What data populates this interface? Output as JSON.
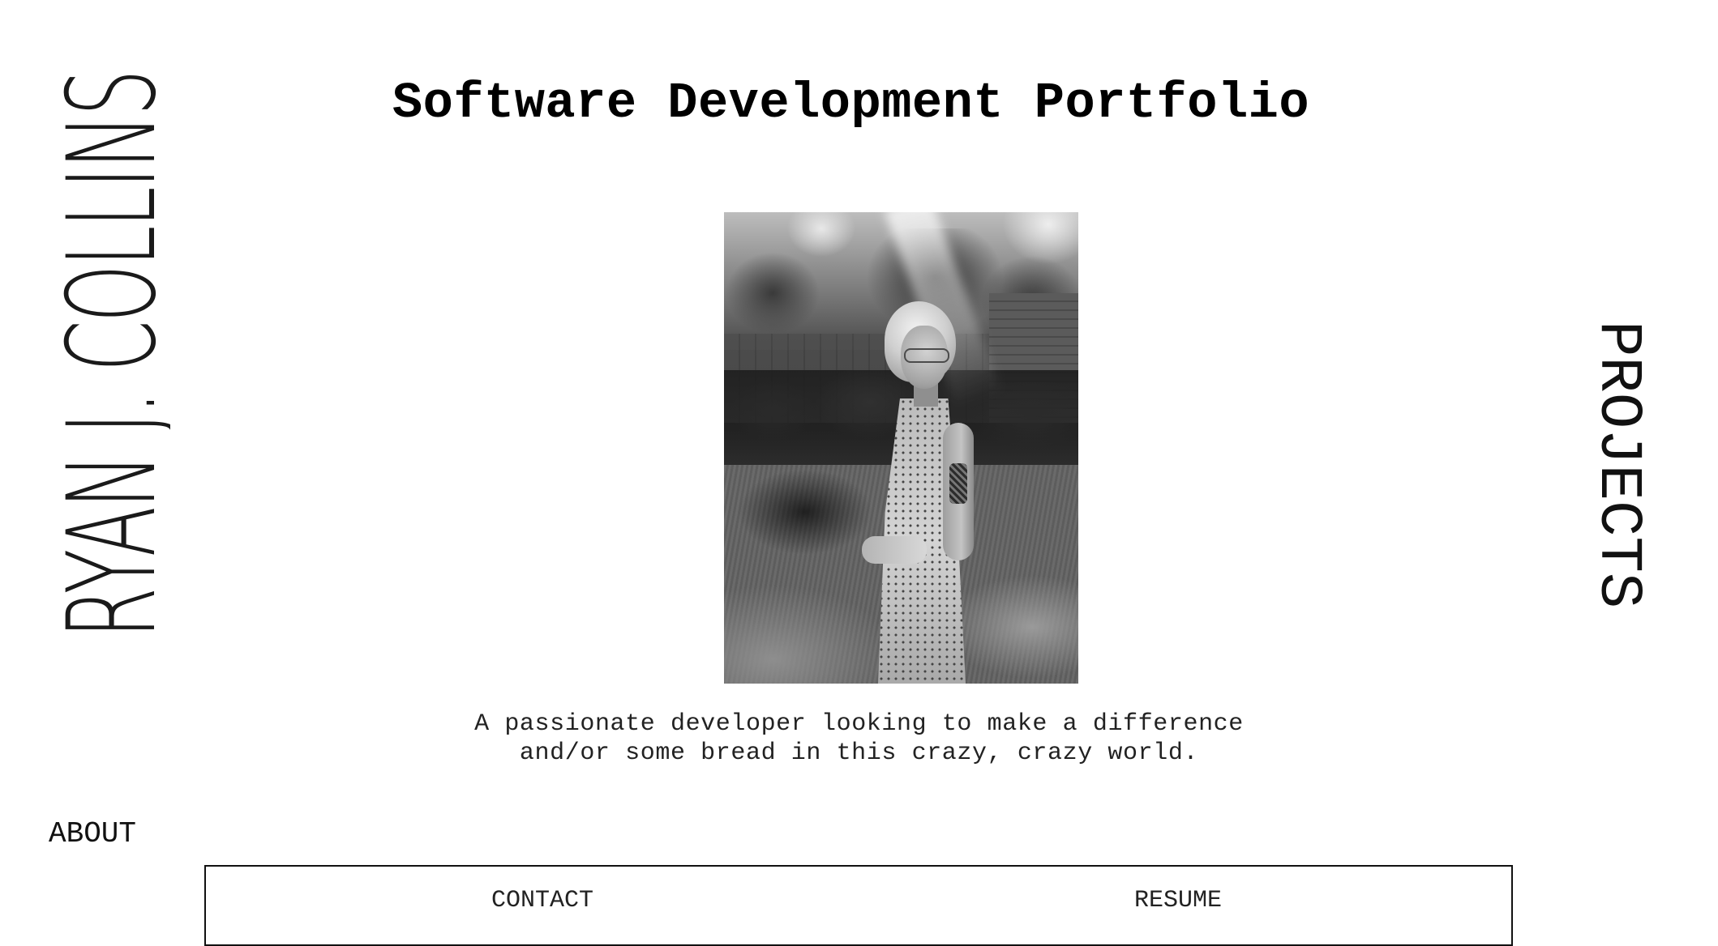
{
  "brand": {
    "name": "RYAN J. COLLINS"
  },
  "header": {
    "title": "Software Development Portfolio"
  },
  "hero": {
    "tagline_line1": "A passionate developer looking to make a difference",
    "tagline_line2": "and/or some bread in this crazy, crazy world."
  },
  "nav": {
    "projects": "PROJECTS",
    "about": "ABOUT",
    "contact": "CONTACT",
    "resume": "RESUME"
  },
  "colors": {
    "background": "#ffffff",
    "text": "#111111",
    "border": "#111111"
  }
}
